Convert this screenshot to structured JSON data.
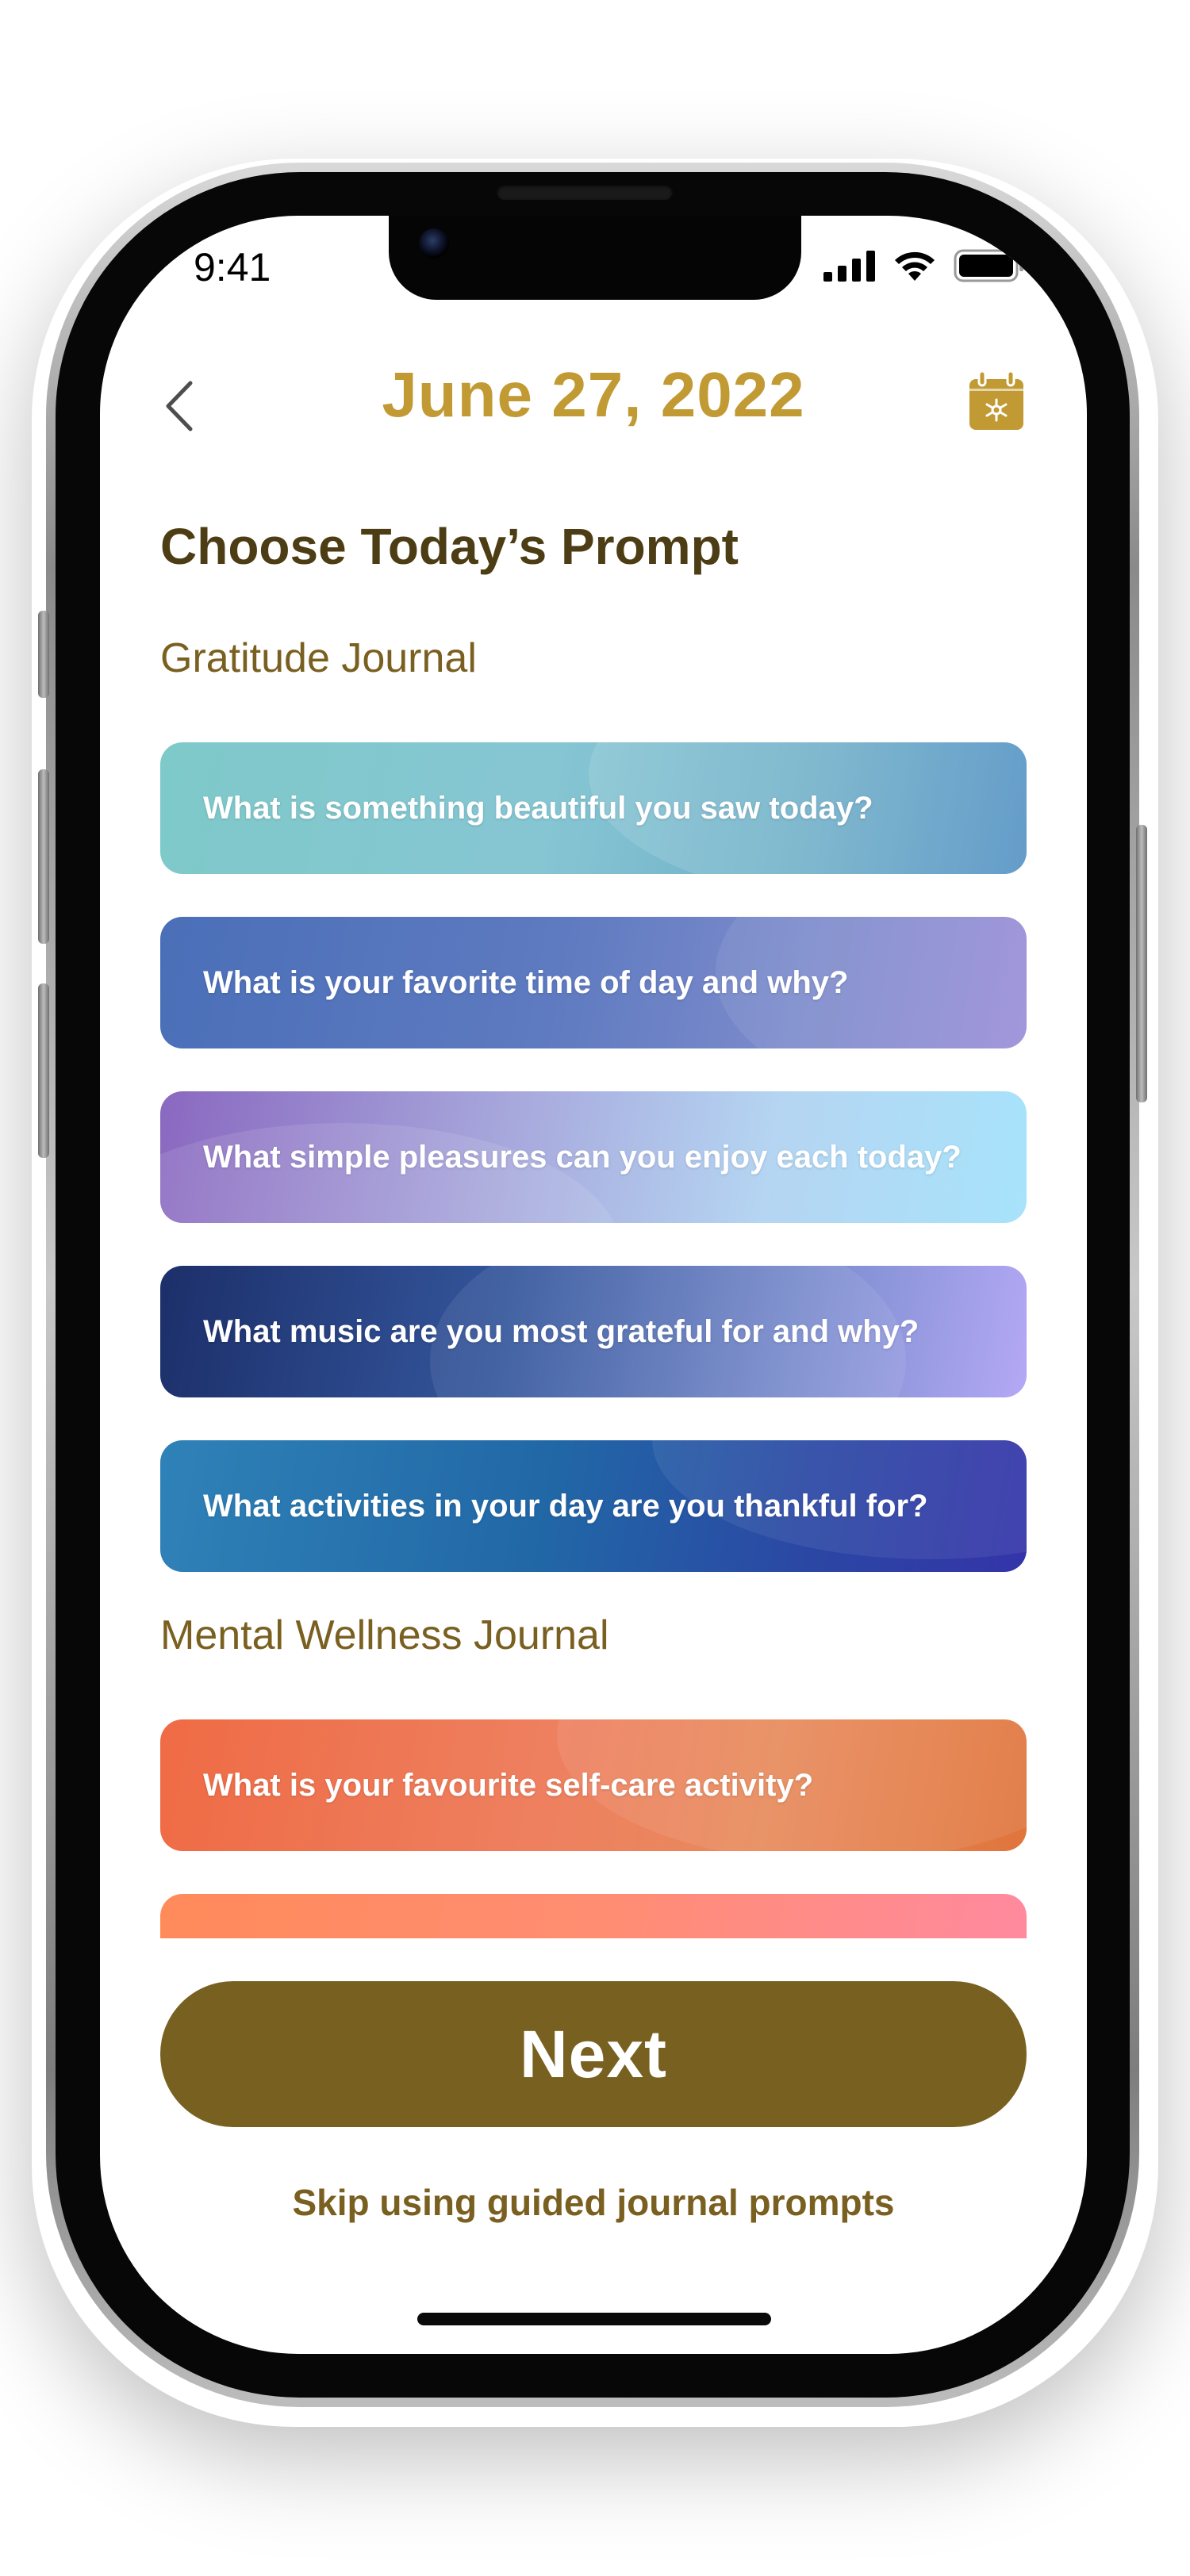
{
  "status_bar": {
    "time": "9:41",
    "icons": [
      "cellular-signal-icon",
      "wifi-icon",
      "battery-icon"
    ]
  },
  "header": {
    "back_icon": "chevron-left-icon",
    "date": "June 27, 2022",
    "calendar_icon": "calendar-icon",
    "accent_color": "#c19a33"
  },
  "page": {
    "heading": "Choose Today’s Prompt"
  },
  "sections": [
    {
      "title": "Gratitude Journal",
      "prompts": [
        "What is something beautiful you saw today?",
        "What is your favorite time of day and why?",
        "What simple pleasures can you enjoy each today?",
        "What music are you most grateful for and why?",
        "What activities in your day are you thankful for?"
      ]
    },
    {
      "title": "Mental Wellness Journal",
      "prompts": [
        "What is your favourite self-care activity?"
      ]
    }
  ],
  "actions": {
    "next_label": "Next",
    "skip_label": "Skip using guided journal prompts",
    "primary_color": "#786120"
  }
}
